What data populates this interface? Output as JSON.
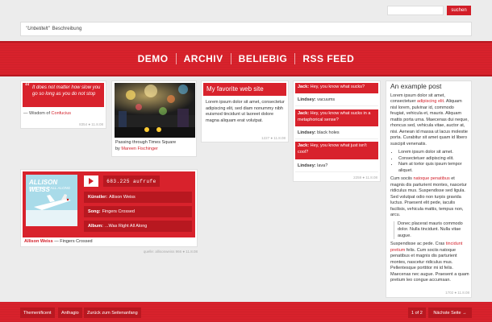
{
  "search": {
    "placeholder": "",
    "button_label": "suchen"
  },
  "title_bar": {
    "italic": "\"Unbetitelt\"",
    "description": "Beschreibung"
  },
  "nav": {
    "items": [
      "DEMO",
      "ARCHIV",
      "BELIEBIG",
      "RSS FEED"
    ]
  },
  "quote": {
    "mark": "“",
    "text": "It does not matter how slow you go so long as you do not stop",
    "source_prefix": "— Wisdom of",
    "source_link": "Confucius",
    "meta": "8354 ● 11.8.08"
  },
  "photo": {
    "caption": "Passing through Times Square",
    "by": "by",
    "author": "Mareen Fischinger"
  },
  "favorite": {
    "title": "My favorite web site",
    "body": "Lorem ipsum dolor sit amet, consectetur adipiscing elit, sed diam nonummy nibh euismod tincidunt ut laoreet dolore magna aliquam erat volutpat.",
    "meta": "1227 ● 11.8.08"
  },
  "chat": {
    "lines": [
      {
        "speaker": "Jack:",
        "text": "Hey, you know what sucks?"
      },
      {
        "speaker": "Lindsey:",
        "text": "vacuums"
      },
      {
        "speaker": "Jack:",
        "text": "Hey, you know what sucks in a metaphorical sense?"
      },
      {
        "speaker": "Lindsey:",
        "text": "black holes"
      },
      {
        "speaker": "Jack:",
        "text": "Hey, you know what just isn't cool?"
      },
      {
        "speaker": "Lindsey:",
        "text": "lava?"
      }
    ],
    "meta": "2259 ● 11.8.08"
  },
  "post": {
    "title": "An example post",
    "p1_before": "Lorem ipsum dolor sit amet, consectetuer",
    "p1_link": "adipiscing elit",
    "p1_after": ". Aliquam nisl lorem, pulvinar id, commodo feugiat, vehicula et, mauris. Aliquam mattis porta urna. Maecenas dui neque, rhoncus sed, vehicula vitae, auctor at, nisi. Aenean id massa ut lacus molestie porta. Curabitur sit amet quam id libero suscipit venenatis.",
    "list": [
      "Lorem ipsum dolor sit amet.",
      "Consectetuer adipiscing elit.",
      "Nam at tortor quis ipsum tempor aliquet."
    ],
    "p2_before": "Cum sociis",
    "p2_link": "natoque penatibus",
    "p2_after": "et magnis dis parturient montes, nascetur ridiculus mus. Suspendisse sed ligula. Sed volutpat odio non turpis gravida luctus. Praesent elit pede, iaculis facilisis, vehicula mattis, tempus non, arcu.",
    "quote": "Donec placerat mauris commodo dolor. Nulla tincidunt. Nulla vitae augue.",
    "p3_before": "Suspendisse ac pede. Cras",
    "p3_link": "tincidunt pretium",
    "p3_after": "felis. Cum sociis natoque penatibus et magnis dis parturient montes, nascetur ridiculus mus. Pellentesque porttitor mi id felis. Maecenas nec augue. Praesent a quam pretium leo congue accumsan.",
    "meta": "1702 ● 11.8.08"
  },
  "audio": {
    "album_title": "ALLISON WEISS",
    "album_sub": "WAS RIGHT ALL ALONG",
    "plays": "683.225 aufrufe",
    "rows": [
      {
        "label": "Künstler:",
        "value": "Allison Weiss"
      },
      {
        "label": "Song:",
        "value": "Fingers Crossed"
      },
      {
        "label": "Album:",
        "value": "...Was Right All Along"
      }
    ],
    "caption_link": "Allison Weiss",
    "caption_rest": "— Fingers Crossed",
    "meta": "quelle: allisonweiss  966 ● 11.8.08"
  },
  "footer": {
    "left": [
      "Themenificent",
      "Anthagio",
      "Zurück zum Seitenanfang"
    ],
    "page": "1 of 2",
    "next": "Nächste Seite →"
  },
  "colors": {
    "accent": "#d8222c",
    "accent_dark": "#b81820",
    "background": "#ececec"
  }
}
